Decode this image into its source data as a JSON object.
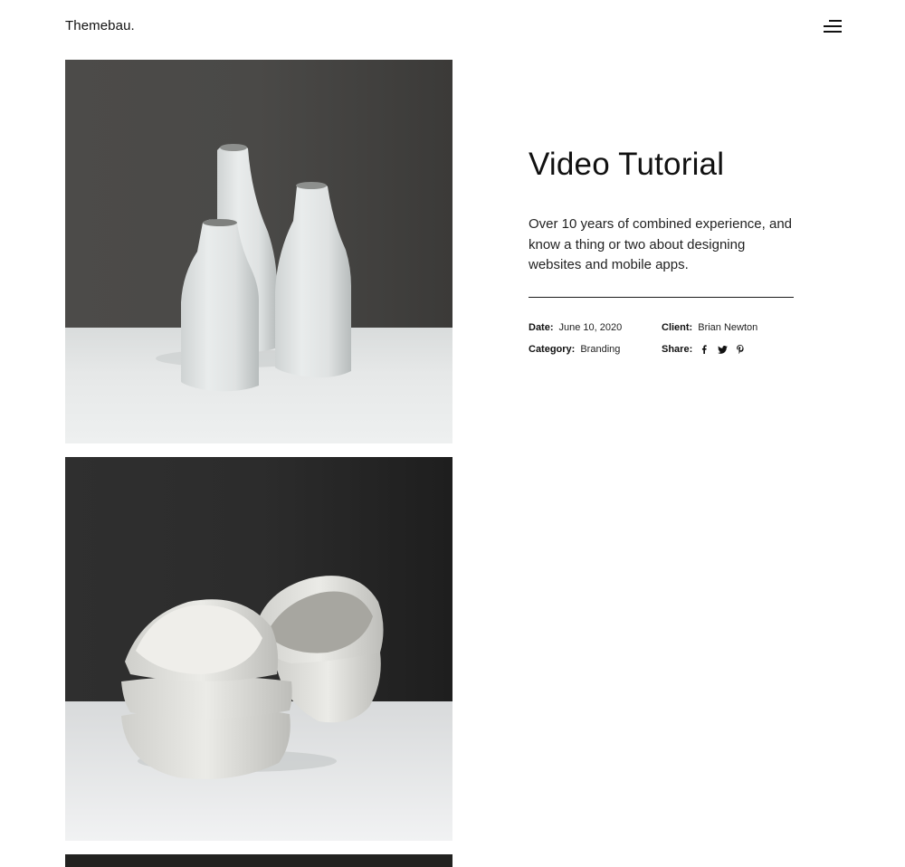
{
  "header": {
    "logo": "Themebau.",
    "menu_icon": "hamburger-menu-icon"
  },
  "project": {
    "title": "Video Tutorial",
    "description": "Over 10 years of combined experience, and know a thing or two about designing websites and mobile apps.",
    "meta": {
      "date_label": "Date:",
      "date_value": "June 10, 2020",
      "client_label": "Client:",
      "client_value": "Brian Newton",
      "category_label": "Category:",
      "category_value": "Branding",
      "share_label": "Share:"
    },
    "share_icons": [
      "facebook-icon",
      "twitter-icon",
      "pinterest-icon"
    ]
  },
  "gallery": {
    "images": [
      "ceramic-vases-photo",
      "ceramic-bowls-photo",
      "third-photo"
    ]
  },
  "colors": {
    "text": "#111111",
    "background": "#ffffff",
    "photo_backdrop_1": "#474644",
    "photo_backdrop_2": "#2a2a2a"
  }
}
